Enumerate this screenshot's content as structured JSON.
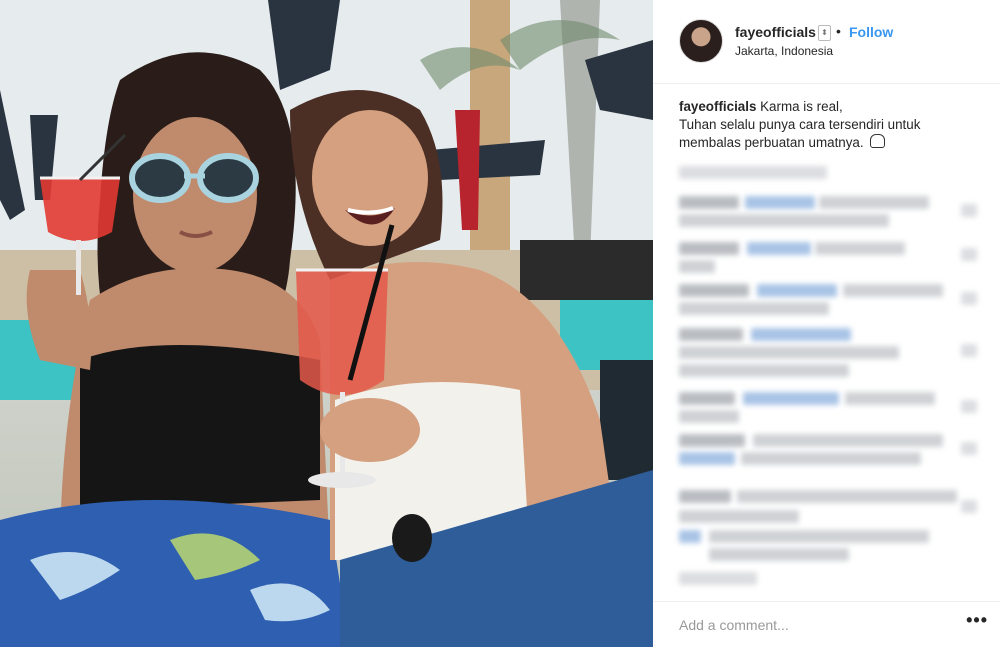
{
  "post": {
    "username": "fayeofficials",
    "follow_separator": "•",
    "follow_label": "Follow",
    "location": "Jakarta, Indonesia",
    "caption_username": "fayeofficials",
    "caption_text_1": " Karma is real,",
    "caption_text_2": "Tuhan selalu punya cara tersendiri untuk",
    "caption_text_3": "membalas perbuatan umatnya."
  },
  "comments_area": {
    "state": "blurred"
  },
  "add_comment": {
    "placeholder": "Add a comment...",
    "more_label": "•••"
  },
  "icons": {
    "avatar": "profile-photo",
    "verify": "sort-arrows-icon",
    "caption_emoji": "headphones-emoji-icon",
    "more": "more-options-icon"
  },
  "colors": {
    "follow": "#3897f0",
    "text": "#262626",
    "placeholder": "#999999"
  }
}
